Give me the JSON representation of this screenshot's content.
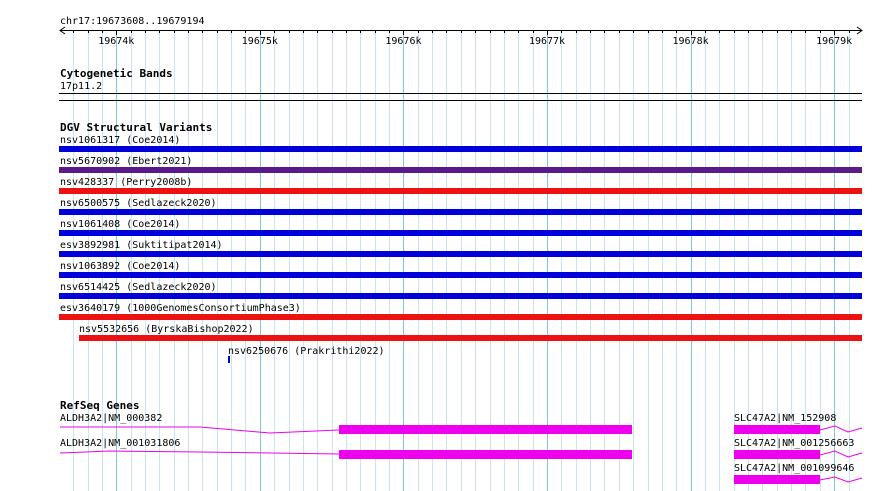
{
  "ruler": {
    "range_label": "chr17:19673608..19679194",
    "ticks": [
      {
        "pos": 19674000,
        "label": "19674k"
      },
      {
        "pos": 19675000,
        "label": "19675k"
      },
      {
        "pos": 19676000,
        "label": "19676k"
      },
      {
        "pos": 19677000,
        "label": "19677k"
      },
      {
        "pos": 19678000,
        "label": "19678k"
      },
      {
        "pos": 19679000,
        "label": "19679k"
      }
    ]
  },
  "cytobands": {
    "title": "Cytogenetic Bands",
    "band_label": "17p11.2"
  },
  "dgv": {
    "title": "DGV Structural Variants",
    "variants": [
      {
        "label": "nsv1061317 (Coe2014)",
        "color": "#0000dd"
      },
      {
        "label": "nsv5670902 (Ebert2021)",
        "color": "#5a1a8c"
      },
      {
        "label": "nsv428337 (Perry2008b)",
        "color": "#ee1111"
      },
      {
        "label": "nsv6500575 (Sedlazeck2020)",
        "color": "#0000dd"
      },
      {
        "label": "nsv1061408 (Coe2014)",
        "color": "#0000dd"
      },
      {
        "label": "esv3892981 (Suktitipat2014)",
        "color": "#0000dd"
      },
      {
        "label": "nsv1063892 (Coe2014)",
        "color": "#0000dd"
      },
      {
        "label": "nsv6514425 (Sedlazeck2020)",
        "color": "#0000dd"
      },
      {
        "label": "esv3640179 (1000GenomesConsortiumPhase3)",
        "color": "#ee1111"
      },
      {
        "label": "nsv5532656 (ByrskaBishop2022)",
        "color": "#ee1111"
      },
      {
        "label": "nsv6250676 (Prakrithi2022)",
        "color": "#0000dd"
      }
    ]
  },
  "refseq": {
    "title": "RefSeq Genes",
    "genes": [
      {
        "label": "ALDH3A2|NM_000382",
        "color": "#ee00ee"
      },
      {
        "label": "ALDH3A2|NM_001031806",
        "color": "#ee00ee"
      },
      {
        "label": "SLC47A2|NM_152908",
        "color": "#ee00ee"
      },
      {
        "label": "SLC47A2|NM_001256663",
        "color": "#ee00ee"
      },
      {
        "label": "SLC47A2|NM_001099646",
        "color": "#ee00ee"
      }
    ]
  }
}
